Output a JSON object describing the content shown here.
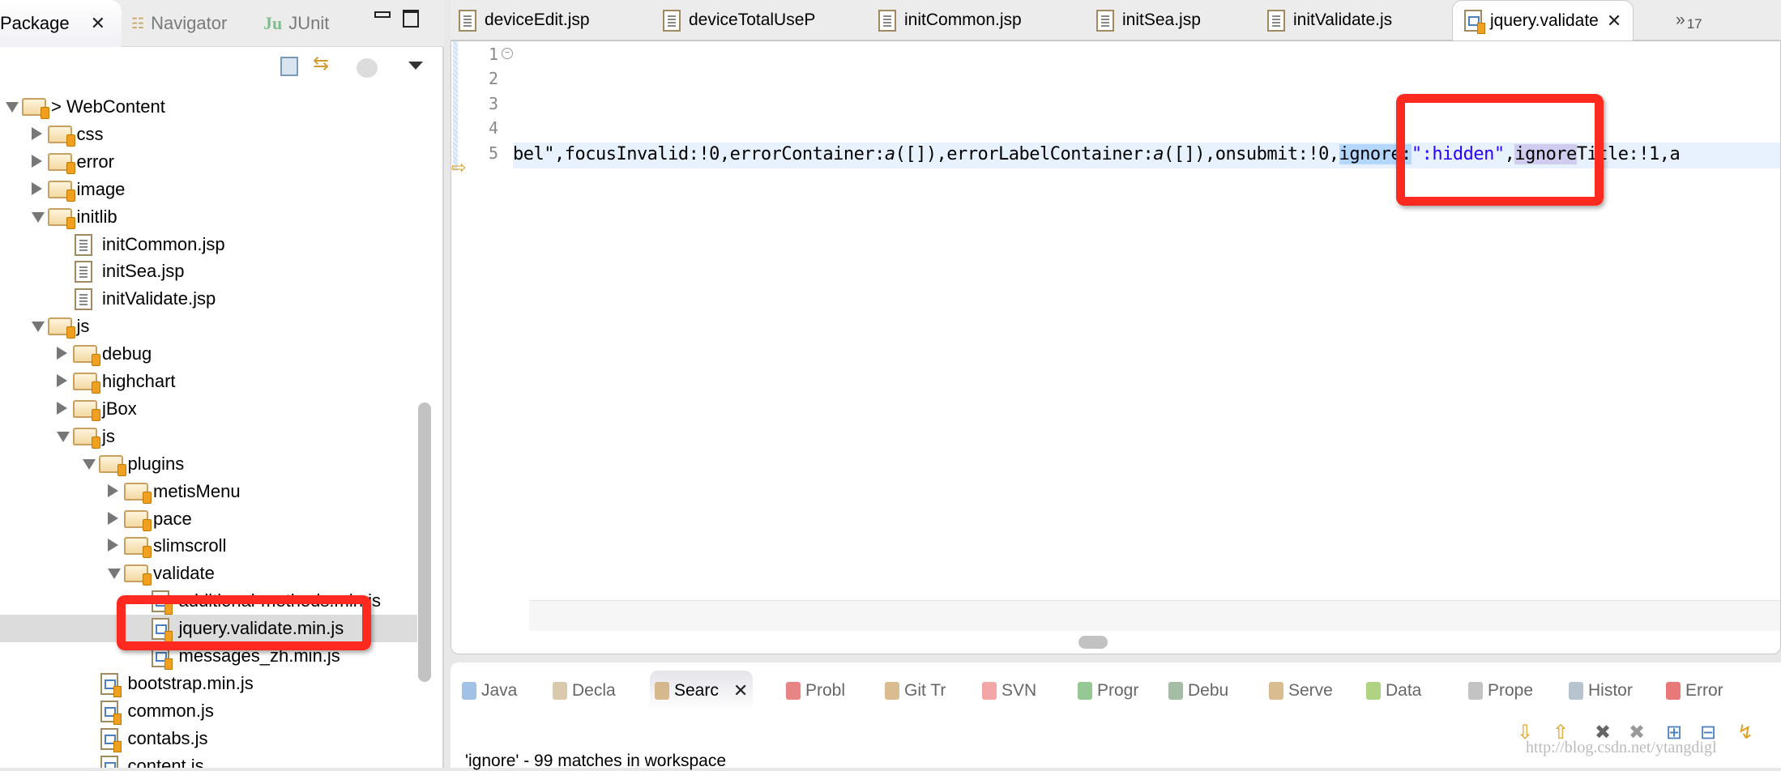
{
  "left_panel": {
    "tabs": [
      {
        "label": "Package",
        "active": true
      },
      {
        "label": "Navigator",
        "active": false
      },
      {
        "label": "JUnit",
        "active": false
      }
    ],
    "tree": [
      {
        "label": "> WebContent",
        "level": 0,
        "type": "folder",
        "expanded": true
      },
      {
        "label": "css",
        "level": 1,
        "type": "folder",
        "expanded": false
      },
      {
        "label": "error",
        "level": 1,
        "type": "folder",
        "expanded": false
      },
      {
        "label": "image",
        "level": 1,
        "type": "folder",
        "expanded": false
      },
      {
        "label": "initlib",
        "level": 1,
        "type": "folder",
        "expanded": true
      },
      {
        "label": "initCommon.jsp",
        "level": 2,
        "type": "jsp"
      },
      {
        "label": "initSea.jsp",
        "level": 2,
        "type": "jsp"
      },
      {
        "label": "initValidate.jsp",
        "level": 2,
        "type": "jsp"
      },
      {
        "label": "js",
        "level": 1,
        "type": "folder",
        "expanded": true
      },
      {
        "label": "debug",
        "level": 2,
        "type": "folder",
        "expanded": false
      },
      {
        "label": "highchart",
        "level": 2,
        "type": "folder",
        "expanded": false
      },
      {
        "label": "jBox",
        "level": 2,
        "type": "folder",
        "expanded": false
      },
      {
        "label": "js",
        "level": 2,
        "type": "folder",
        "expanded": true
      },
      {
        "label": "plugins",
        "level": 3,
        "type": "folder",
        "expanded": true
      },
      {
        "label": "metisMenu",
        "level": 4,
        "type": "folder",
        "expanded": false
      },
      {
        "label": "pace",
        "level": 4,
        "type": "folder",
        "expanded": false
      },
      {
        "label": "slimscroll",
        "level": 4,
        "type": "folder",
        "expanded": false
      },
      {
        "label": "validate",
        "level": 4,
        "type": "folder",
        "expanded": true
      },
      {
        "label": "additional-methods.min.js",
        "level": 5,
        "type": "js"
      },
      {
        "label": "jquery.validate.min.js",
        "level": 5,
        "type": "js",
        "selected": true
      },
      {
        "label": "messages_zh.min.js",
        "level": 5,
        "type": "js"
      },
      {
        "label": "bootstrap.min.js",
        "level": 3,
        "type": "js"
      },
      {
        "label": "common.js",
        "level": 3,
        "type": "js"
      },
      {
        "label": "contabs.js",
        "level": 3,
        "type": "js"
      },
      {
        "label": "content.js",
        "level": 3,
        "type": "js"
      }
    ]
  },
  "editor": {
    "tabs": [
      {
        "label": "deviceEdit.jsp",
        "icon": "jsp-file-icon"
      },
      {
        "label": "deviceTotalUseP",
        "icon": "jsp-file-icon"
      },
      {
        "label": "initCommon.jsp",
        "icon": "jsp-file-icon"
      },
      {
        "label": "initSea.jsp",
        "icon": "jsp-file-icon"
      },
      {
        "label": "initValidate.js",
        "icon": "jsp-file-icon"
      },
      {
        "label": "jquery.validate",
        "icon": "js-file-icon",
        "active": true
      }
    ],
    "overflow_tabs": "17",
    "line_numbers": [
      "1",
      "2",
      "3",
      "4",
      "5"
    ],
    "line4": {
      "a": "bel\",focusInvalid:!0,errorContainer:",
      "b": "a",
      "c": "([]),errorLabelContainer:",
      "d": "a",
      "e": "([]),onsubmit:!0",
      "f": ",",
      "g": "ignore:",
      "h": "\":hidden\"",
      "i": ",",
      "j": "ignore",
      "k": "Title:!1,a"
    }
  },
  "bottom_panel": {
    "tabs": [
      {
        "label": "Java"
      },
      {
        "label": "Decla"
      },
      {
        "label": "Searc",
        "active": true
      },
      {
        "label": "Probl"
      },
      {
        "label": "Git Tr"
      },
      {
        "label": "SVN"
      },
      {
        "label": "Progr"
      },
      {
        "label": "Debu"
      },
      {
        "label": "Serve"
      },
      {
        "label": "Data"
      },
      {
        "label": "Prope"
      },
      {
        "label": "Histor"
      },
      {
        "label": "Error"
      }
    ],
    "result_text": "'ignore' - 99 matches in workspace",
    "watermark": "http://blog.csdn.net/ytangdigl"
  },
  "colors": {
    "highlight_box": "#ff2a1f",
    "selection": "#b3d7ff",
    "occurrence": "#d0ccf0",
    "string": "#2a00ff"
  }
}
